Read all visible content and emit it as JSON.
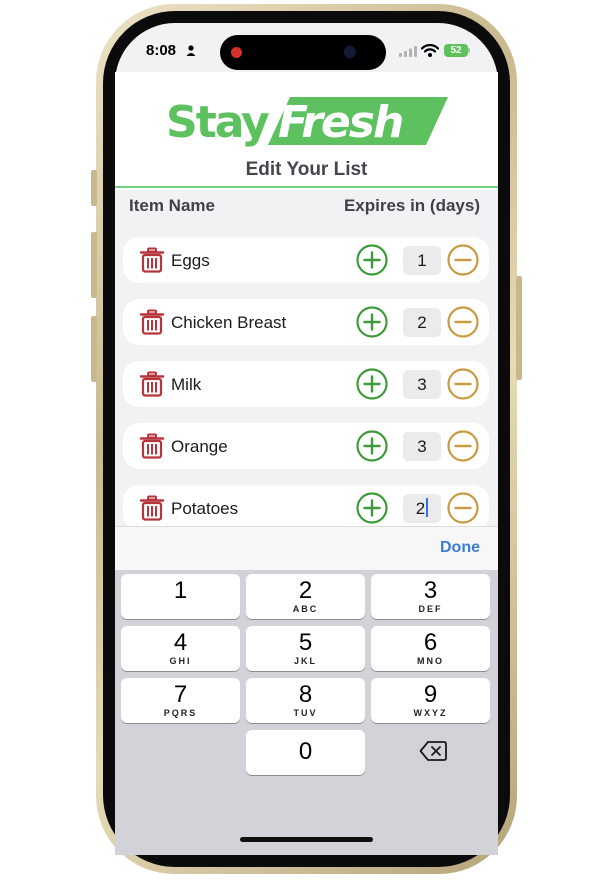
{
  "status_bar": {
    "time": "8:08",
    "battery": "52"
  },
  "header": {
    "logo_text": "StayFresh",
    "title": "Edit Your List"
  },
  "columns": {
    "name": "Item Name",
    "expires": "Expires in (days)"
  },
  "items": [
    {
      "name": "Eggs",
      "days": "1"
    },
    {
      "name": "Chicken Breast",
      "days": "2"
    },
    {
      "name": "Milk",
      "days": "3"
    },
    {
      "name": "Orange",
      "days": "3"
    },
    {
      "name": "Potatoes",
      "days": "2"
    }
  ],
  "keyboard": {
    "done_label": "Done",
    "keys": [
      {
        "num": "1",
        "letters": ""
      },
      {
        "num": "2",
        "letters": "ABC"
      },
      {
        "num": "3",
        "letters": "DEF"
      },
      {
        "num": "4",
        "letters": "GHI"
      },
      {
        "num": "5",
        "letters": "JKL"
      },
      {
        "num": "6",
        "letters": "MNO"
      },
      {
        "num": "7",
        "letters": "PQRS"
      },
      {
        "num": "8",
        "letters": "TUV"
      },
      {
        "num": "9",
        "letters": "WXYZ"
      },
      {
        "num": "0",
        "letters": ""
      }
    ],
    "delete_icon": "delete-left-icon"
  },
  "colors": {
    "brand_green": "#5cc15e",
    "plus_green": "#3f9a3c",
    "minus_gold": "#c99a41",
    "trash_red": "#b8343c",
    "done_blue": "#3b7bd4"
  }
}
